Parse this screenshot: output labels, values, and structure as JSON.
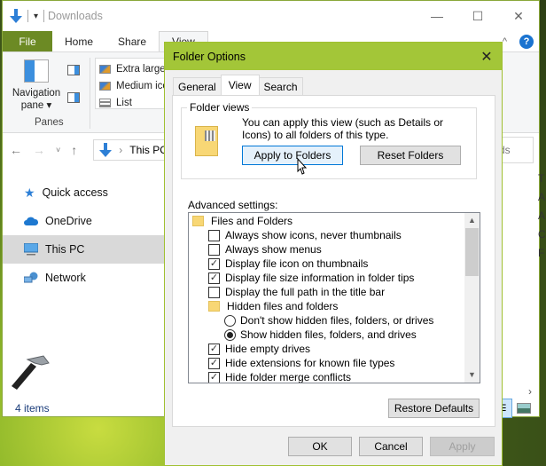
{
  "explorer": {
    "title": "Downloads",
    "window_controls": {
      "minimize": "—",
      "maximize": "☐",
      "close": "✕"
    },
    "ribbon_tabs": [
      {
        "label": "File"
      },
      {
        "label": "Home"
      },
      {
        "label": "Share"
      },
      {
        "label": "View"
      }
    ],
    "ribbon": {
      "navigation_pane_label": "Navigation pane ▾",
      "panes_group": "Panes",
      "layout_options": [
        "Extra large",
        "Medium icons",
        "List"
      ]
    },
    "address": {
      "path": "This PC",
      "separator": "›",
      "search_fragment": "ds"
    },
    "nav_items": [
      {
        "label": "Quick access",
        "icon": "star-icon"
      },
      {
        "label": "OneDrive",
        "icon": "cloud-icon"
      },
      {
        "label": "This PC",
        "icon": "computer-icon",
        "selected": true
      },
      {
        "label": "Network",
        "icon": "network-icon"
      }
    ],
    "right_column_fragments": [
      "T",
      "A",
      "A",
      "C",
      "F"
    ],
    "status": "4 items"
  },
  "dialog": {
    "title": "Folder Options",
    "tabs": [
      {
        "label": "General"
      },
      {
        "label": "View",
        "active": true
      },
      {
        "label": "Search"
      }
    ],
    "folder_views": {
      "label": "Folder views",
      "description": "You can apply this view (such as Details or Icons) to all folders of this type.",
      "apply_button": "Apply to Folders",
      "reset_button": "Reset Folders"
    },
    "advanced_label": "Advanced settings:",
    "advanced_items": [
      {
        "type": "folder",
        "label": "Files and Folders",
        "level": 0
      },
      {
        "type": "checkbox",
        "label": "Always show icons, never thumbnails",
        "checked": false,
        "level": 1
      },
      {
        "type": "checkbox",
        "label": "Always show menus",
        "checked": false,
        "level": 1
      },
      {
        "type": "checkbox",
        "label": "Display file icon on thumbnails",
        "checked": true,
        "level": 1
      },
      {
        "type": "checkbox",
        "label": "Display file size information in folder tips",
        "checked": true,
        "level": 1
      },
      {
        "type": "checkbox",
        "label": "Display the full path in the title bar",
        "checked": false,
        "level": 1
      },
      {
        "type": "folder",
        "label": "Hidden files and folders",
        "level": 1
      },
      {
        "type": "radio",
        "label": "Don't show hidden files, folders, or drives",
        "checked": false,
        "level": 2
      },
      {
        "type": "radio",
        "label": "Show hidden files, folders, and drives",
        "checked": true,
        "level": 2
      },
      {
        "type": "checkbox",
        "label": "Hide empty drives",
        "checked": true,
        "level": 1
      },
      {
        "type": "checkbox",
        "label": "Hide extensions for known file types",
        "checked": true,
        "level": 1
      },
      {
        "type": "checkbox",
        "label": "Hide folder merge conflicts",
        "checked": true,
        "level": 1
      }
    ],
    "restore_defaults": "Restore Defaults",
    "ok": "OK",
    "cancel": "Cancel",
    "apply": "Apply",
    "accent_color": "#a3c638"
  }
}
